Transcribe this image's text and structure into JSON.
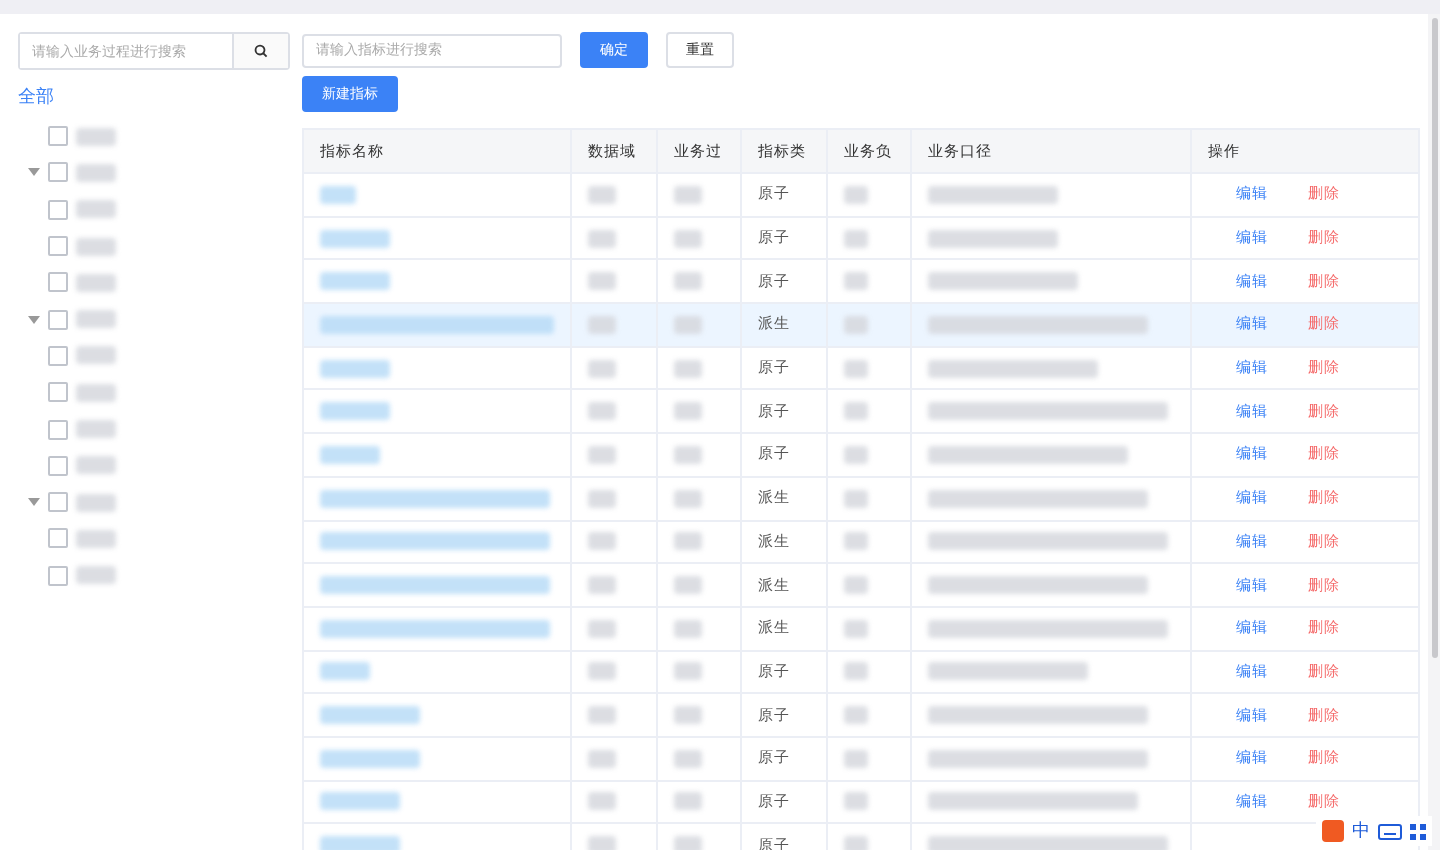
{
  "sidebar": {
    "search": {
      "placeholder": "请输入业务过程进行搜索"
    },
    "root_label": "全部",
    "tree": [
      {
        "checked": false
      },
      {
        "checked": false,
        "expanded": true,
        "children": [
          {
            "checked": false
          },
          {
            "checked": false
          },
          {
            "checked": false
          }
        ]
      },
      {
        "checked": false,
        "expanded": true,
        "children": [
          {
            "checked": false
          },
          {
            "checked": false
          },
          {
            "checked": false
          },
          {
            "checked": false
          }
        ]
      },
      {
        "checked": false,
        "expanded": true,
        "children": [
          {
            "checked": false
          },
          {
            "checked": false
          }
        ]
      }
    ]
  },
  "toolbar": {
    "search": {
      "placeholder": "请输入指标进行搜索"
    },
    "confirm": "确定",
    "reset": "重置",
    "create": "新建指标"
  },
  "table": {
    "columns": [
      "指标名称",
      "数据域",
      "业务过",
      "指标类",
      "业务负",
      "业务口径",
      "操作"
    ],
    "rows": [
      {
        "type": "原子",
        "highlighted": false,
        "edit": "编辑",
        "delete": "删除"
      },
      {
        "type": "原子",
        "highlighted": false,
        "edit": "编辑",
        "delete": "删除"
      },
      {
        "type": "原子",
        "highlighted": false,
        "edit": "编辑",
        "delete": "删除"
      },
      {
        "type": "派生",
        "highlighted": true,
        "edit": "编辑",
        "delete": "删除"
      },
      {
        "type": "原子",
        "highlighted": false,
        "edit": "编辑",
        "delete": "删除"
      },
      {
        "type": "原子",
        "highlighted": false,
        "edit": "编辑",
        "delete": "删除"
      },
      {
        "type": "原子",
        "highlighted": false,
        "edit": "编辑",
        "delete": "删除"
      },
      {
        "type": "派生",
        "highlighted": false,
        "edit": "编辑",
        "delete": "删除"
      },
      {
        "type": "派生",
        "highlighted": false,
        "edit": "编辑",
        "delete": "删除"
      },
      {
        "type": "派生",
        "highlighted": false,
        "edit": "编辑",
        "delete": "删除"
      },
      {
        "type": "派生",
        "highlighted": false,
        "edit": "编辑",
        "delete": "删除"
      },
      {
        "type": "原子",
        "highlighted": false,
        "edit": "编辑",
        "delete": "删除"
      },
      {
        "type": "原子",
        "highlighted": false,
        "edit": "编辑",
        "delete": "删除"
      },
      {
        "type": "原子",
        "highlighted": false,
        "edit": "编辑",
        "delete": "删除"
      },
      {
        "type": "原子",
        "highlighted": false,
        "edit": "编辑",
        "delete": "删除"
      },
      {
        "type": "原子",
        "highlighted": false
      }
    ]
  },
  "ime_toolbar": {
    "mode": "中"
  }
}
